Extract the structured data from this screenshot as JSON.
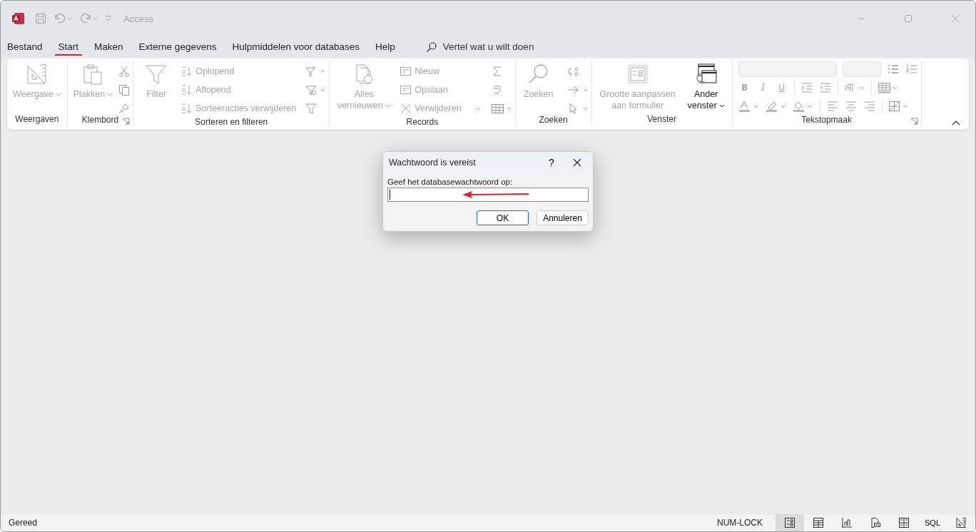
{
  "window": {
    "title": "Access"
  },
  "tabs": [
    {
      "label": "Bestand",
      "selected": false
    },
    {
      "label": "Start",
      "selected": true
    },
    {
      "label": "Maken",
      "selected": false
    },
    {
      "label": "Externe gegevens",
      "selected": false
    },
    {
      "label": "Hulpmiddelen voor databases",
      "selected": false
    },
    {
      "label": "Help",
      "selected": false
    }
  ],
  "search": {
    "placeholder": "Vertel wat u wilt doen"
  },
  "ribbon": {
    "groups": [
      {
        "kind": "views",
        "label": "Weergaven",
        "items": [
          {
            "kind": "large",
            "label": "Weergave",
            "disabled": true,
            "dropdown": true
          }
        ]
      },
      {
        "kind": "clipboard",
        "label": "Klembord",
        "launcher": true,
        "items": [
          {
            "kind": "large",
            "label": "Plakken",
            "disabled": true,
            "dropdown": true
          }
        ]
      },
      {
        "kind": "sort",
        "label": "Sorteren en filteren",
        "items": [
          {
            "kind": "large",
            "label": "Filter",
            "disabled": true
          },
          {
            "kind": "small",
            "label": "Oplopend",
            "disabled": true
          },
          {
            "kind": "small",
            "label": "Aflopend",
            "disabled": true
          },
          {
            "kind": "small",
            "label": "Sorteeracties verwijderen",
            "disabled": true
          }
        ]
      },
      {
        "kind": "records",
        "label": "Records",
        "items": [
          {
            "kind": "large",
            "label": "Alles vernieuwen",
            "disabled": true,
            "dropdown": true
          },
          {
            "kind": "small",
            "label": "Nieuw",
            "disabled": true
          },
          {
            "kind": "small",
            "label": "Opslaan",
            "disabled": true
          },
          {
            "kind": "small",
            "label": "Verwijderen",
            "disabled": true,
            "dropdown": true
          }
        ]
      },
      {
        "kind": "find",
        "label": "Zoeken",
        "items": [
          {
            "kind": "large",
            "label": "Zoeken",
            "disabled": true
          }
        ]
      },
      {
        "kind": "window",
        "label": "Venster",
        "items": [
          {
            "kind": "large",
            "label": "Grootte aanpassen aan formulier",
            "disabled": true
          },
          {
            "kind": "large",
            "label": "Ander venster",
            "disabled": false,
            "dropdown": true
          }
        ]
      },
      {
        "kind": "text",
        "label": "Tekstopmaak",
        "launcher": true,
        "format_buttons": [
          "B",
          "I",
          "U"
        ]
      }
    ]
  },
  "dialog": {
    "title": "Wachtwoord is vereist",
    "help": "?",
    "prompt": "Geef het databasewachtwoord op:",
    "field": {
      "focused": true
    },
    "buttons": [
      {
        "label": "OK",
        "default": true
      },
      {
        "label": "Annuleren",
        "default": false
      }
    ]
  },
  "status_bar": {
    "text": "Gereed",
    "indicator": "NUM-LOCK",
    "views": [
      {
        "selected": true
      },
      {
        "selected": false
      },
      {
        "selected": false
      },
      {
        "selected": false
      },
      {
        "selected": false
      },
      {
        "label": "SQL",
        "selected": false
      },
      {
        "selected": false
      }
    ]
  }
}
